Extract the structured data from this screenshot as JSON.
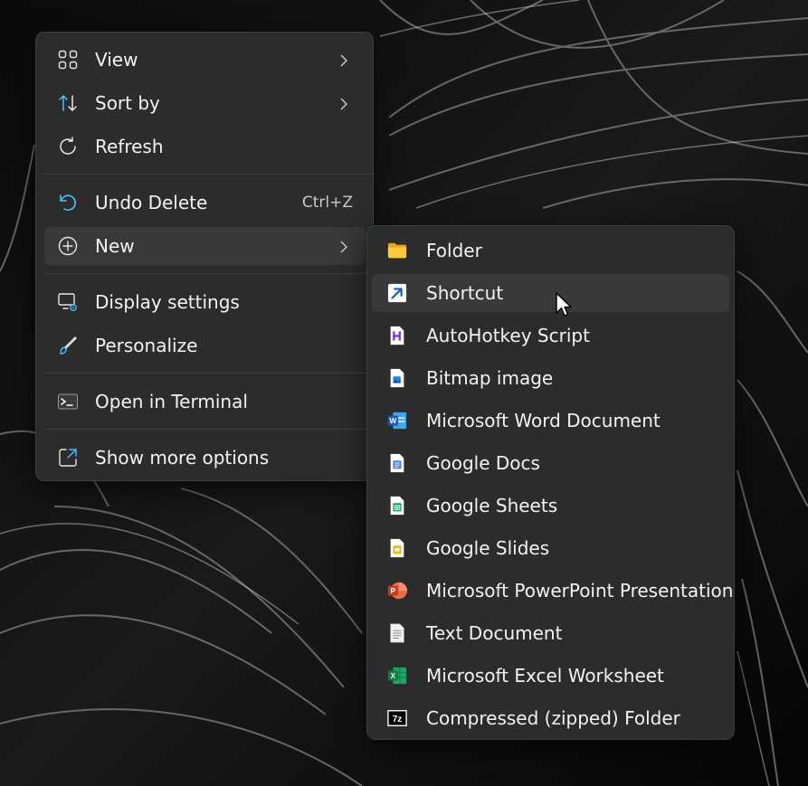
{
  "main_menu": {
    "items": [
      {
        "label": "View",
        "icon": "view-grid-icon"
      },
      {
        "label": "Sort by",
        "icon": "sort-icon"
      },
      {
        "label": "Refresh",
        "icon": "refresh-icon"
      },
      {
        "label": "Undo Delete",
        "icon": "undo-icon",
        "shortcut": "Ctrl+Z"
      },
      {
        "label": "New",
        "icon": "new-plus-icon"
      },
      {
        "label": "Display settings",
        "icon": "display-settings-icon"
      },
      {
        "label": "Personalize",
        "icon": "brush-icon"
      },
      {
        "label": "Open in Terminal",
        "icon": "terminal-icon"
      },
      {
        "label": "Show more options",
        "icon": "more-options-icon"
      }
    ]
  },
  "new_submenu": {
    "items": [
      {
        "label": "Folder",
        "icon": "folder-icon"
      },
      {
        "label": "Shortcut",
        "icon": "shortcut-icon"
      },
      {
        "label": "AutoHotkey Script",
        "icon": "autohotkey-icon"
      },
      {
        "label": "Bitmap image",
        "icon": "bitmap-icon"
      },
      {
        "label": "Microsoft Word Document",
        "icon": "word-icon"
      },
      {
        "label": "Google Docs",
        "icon": "google-docs-icon"
      },
      {
        "label": "Google Sheets",
        "icon": "google-sheets-icon"
      },
      {
        "label": "Google Slides",
        "icon": "google-slides-icon"
      },
      {
        "label": "Microsoft PowerPoint Presentation",
        "icon": "powerpoint-icon"
      },
      {
        "label": "Text Document",
        "icon": "text-document-icon"
      },
      {
        "label": "Microsoft Excel Worksheet",
        "icon": "excel-icon"
      },
      {
        "label": "Compressed (zipped) Folder",
        "icon": "zip-icon"
      }
    ]
  },
  "colors": {
    "menu_bg": "#2c2c2c",
    "highlight": "#393939",
    "accent": "#4cc2ff",
    "text": "#f3f3f3"
  }
}
